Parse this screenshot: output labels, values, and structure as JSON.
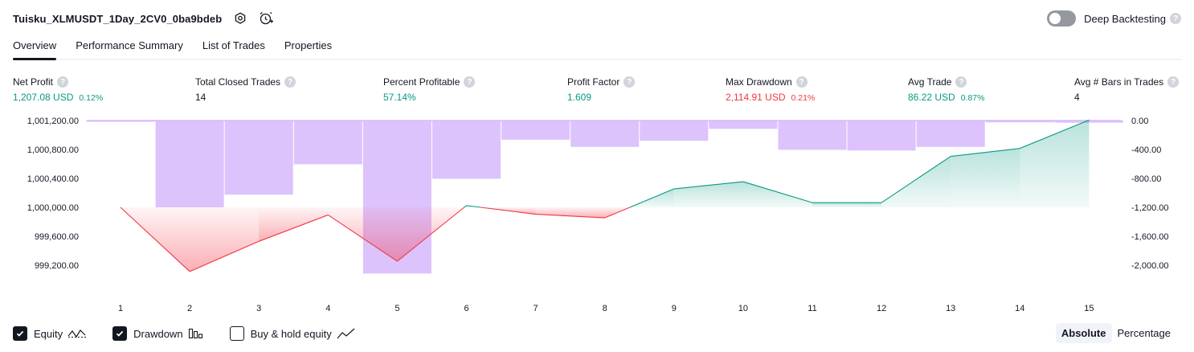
{
  "header": {
    "strategy_name": "Tuisku_XLMUSDT_1Day_2CV0_0ba9bdeb",
    "settings_icon": "settings-hex-icon",
    "alert_icon": "alarm-clock-plus-icon",
    "deep_backtesting_label": "Deep Backtesting",
    "deep_backtesting_enabled": false,
    "help_glyph": "?"
  },
  "tabs": [
    {
      "label": "Overview",
      "active": true
    },
    {
      "label": "Performance Summary",
      "active": false
    },
    {
      "label": "List of Trades",
      "active": false
    },
    {
      "label": "Properties",
      "active": false
    }
  ],
  "metrics": [
    {
      "label": "Net Profit",
      "value": "1,207.08 USD",
      "pct": "0.12%",
      "tone": "pos"
    },
    {
      "label": "Total Closed Trades",
      "value": "14",
      "pct": "",
      "tone": "neu"
    },
    {
      "label": "Percent Profitable",
      "value": "57.14%",
      "pct": "",
      "tone": "pos"
    },
    {
      "label": "Profit Factor",
      "value": "1.609",
      "pct": "",
      "tone": "pos"
    },
    {
      "label": "Max Drawdown",
      "value": "2,114.91 USD",
      "pct": "0.21%",
      "tone": "neg"
    },
    {
      "label": "Avg Trade",
      "value": "86.22 USD",
      "pct": "0.87%",
      "tone": "pos"
    },
    {
      "label": "Avg # Bars in Trades",
      "value": "4",
      "pct": "",
      "tone": "neu"
    }
  ],
  "chart_data": {
    "type": "line",
    "x": [
      1,
      2,
      3,
      4,
      5,
      6,
      7,
      8,
      9,
      10,
      11,
      12,
      13,
      14,
      15
    ],
    "x_tick_labels": [
      "1",
      "2",
      "3",
      "4",
      "5",
      "6",
      "7",
      "8",
      "9",
      "10",
      "11",
      "12",
      "13",
      "14",
      "15"
    ],
    "left_axis": {
      "ticks": [
        "1,001,200.00",
        "1,000,800.00",
        "1,000,400.00",
        "1,000,000.00",
        "999,600.00",
        "999,200.00"
      ],
      "ylim": [
        999000,
        1001200
      ]
    },
    "right_axis": {
      "ticks": [
        "0.00",
        "-400.00",
        "-800.00",
        "-1,200.00",
        "-1,600.00",
        "-2,000.00"
      ],
      "ylim": [
        -2200,
        0
      ]
    },
    "baseline": 1000000,
    "series": [
      {
        "name": "Equity",
        "axis": "left",
        "values": [
          1000000,
          999113,
          999530,
          999895,
          999255,
          1000025,
          999905,
          999855,
          1000255,
          1000355,
          1000065,
          1000065,
          1000705,
          1000815,
          1001207
        ],
        "colors": {
          "up": "#089981",
          "down": "#f23645"
        }
      },
      {
        "name": "Drawdown",
        "axis": "right",
        "type": "bar",
        "values": [
          -15,
          -1200,
          -1025,
          -605,
          -2115,
          -805,
          -265,
          -365,
          -280,
          -115,
          -405,
          -415,
          -365,
          -25,
          -30
        ],
        "color": "#d7b8fb"
      }
    ],
    "grid": false
  },
  "legend": [
    {
      "label": "Equity",
      "checked": true,
      "icon": "equity-line-icon"
    },
    {
      "label": "Drawdown",
      "checked": true,
      "icon": "drawdown-bars-icon"
    },
    {
      "label": "Buy & hold equity",
      "checked": false,
      "icon": "buy-hold-line-icon"
    }
  ],
  "scale_mode": {
    "options": [
      "Absolute",
      "Percentage"
    ],
    "selected": "Absolute"
  }
}
